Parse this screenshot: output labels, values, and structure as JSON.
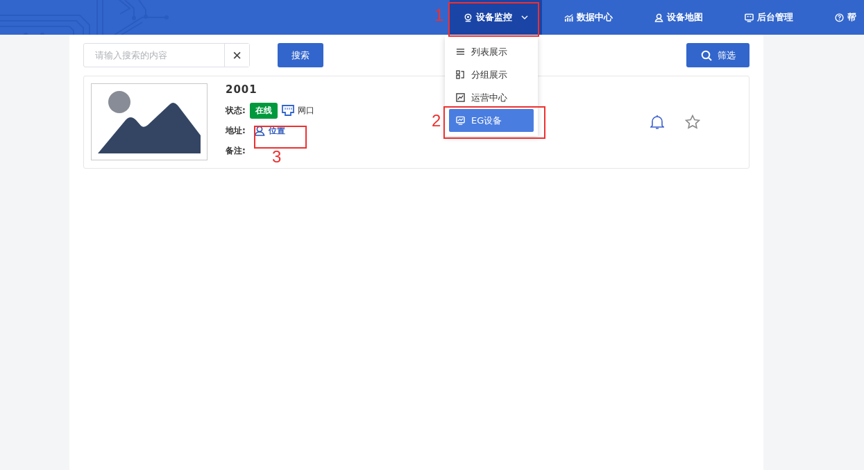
{
  "nav": {
    "items": [
      {
        "label": "设备监控",
        "selected": true,
        "dropdown": true
      },
      {
        "label": "数据中心",
        "selected": false,
        "dropdown": false
      },
      {
        "label": "设备地图",
        "selected": false,
        "dropdown": false
      },
      {
        "label": "后台管理",
        "selected": false,
        "dropdown": false
      },
      {
        "label": "帮",
        "selected": false,
        "dropdown": false
      }
    ]
  },
  "menu": {
    "items": [
      {
        "label": "列表展示",
        "selected": false
      },
      {
        "label": "分组展示",
        "selected": false
      },
      {
        "label": "运营中心",
        "selected": false
      },
      {
        "label": "EG设备",
        "selected": true
      }
    ]
  },
  "search": {
    "placeholder": "请输入搜索的内容",
    "clear": "✕",
    "button": "搜索"
  },
  "filter_button": "筛选",
  "device": {
    "name": "2001",
    "status_label": "状态:",
    "status": "在线",
    "port": "网口",
    "address_label": "地址:",
    "location": "位置",
    "note_label": "备注:"
  },
  "annotations": [
    {
      "label": "1"
    },
    {
      "label": "2"
    },
    {
      "label": "3"
    }
  ]
}
